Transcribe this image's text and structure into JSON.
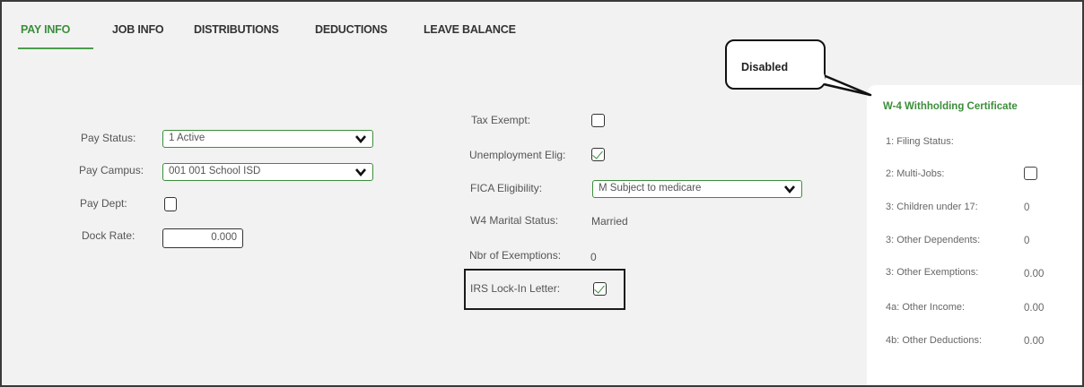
{
  "tabs": [
    {
      "label": "PAY INFO",
      "active": true
    },
    {
      "label": "JOB INFO",
      "active": false
    },
    {
      "label": "DISTRIBUTIONS",
      "active": false
    },
    {
      "label": "DEDUCTIONS",
      "active": false
    },
    {
      "label": "LEAVE BALANCE",
      "active": false
    }
  ],
  "left": {
    "pay_status_label": "Pay Status:",
    "pay_status_value": "1 Active",
    "pay_campus_label": "Pay Campus:",
    "pay_campus_value": "001 001 School ISD",
    "pay_dept_label": "Pay Dept:",
    "pay_dept_checked": false,
    "dock_rate_label": "Dock Rate:",
    "dock_rate_value": "0.000"
  },
  "middle": {
    "tax_exempt_label": "Tax Exempt:",
    "tax_exempt_checked": false,
    "unemployment_label": "Unemployment Elig:",
    "unemployment_checked": true,
    "fica_label": "FICA Eligibility:",
    "fica_value": "M Subject to medicare",
    "w4_marital_label": "W4 Marital Status:",
    "w4_marital_value": "Married",
    "exemptions_label": "Nbr of Exemptions:",
    "exemptions_value": "0",
    "irs_label": "IRS Lock-In Letter:",
    "irs_checked": true
  },
  "callout": {
    "text": "Disabled"
  },
  "w4": {
    "title": "W-4 Withholding Certificate",
    "filing_status_label": "1: Filing Status:",
    "multi_jobs_label": "2: Multi-Jobs:",
    "multi_jobs_checked": false,
    "children_label": "3: Children under 17:",
    "children_value": "0",
    "other_dependents_label": "3: Other Dependents:",
    "other_dependents_value": "0",
    "other_exemptions_label": "3: Other Exemptions:",
    "other_exemptions_value": "0.00",
    "other_income_label": "4a: Other Income:",
    "other_income_value": "0.00",
    "other_deductions_label": "4b: Other Deductions:",
    "other_deductions_value": "0.00"
  },
  "colors": {
    "accent": "#3b8e3b",
    "panel_bg": "#ffffff",
    "page_bg": "#f2f2f2"
  }
}
